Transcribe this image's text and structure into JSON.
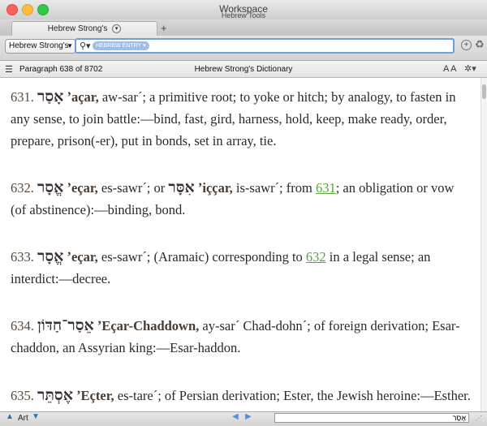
{
  "window": {
    "title": "Workspace",
    "subtitle": "Hebrew Tools"
  },
  "tab": {
    "label": "Hebrew Strong's",
    "add_symbol": "+"
  },
  "toolbar": {
    "resource": "Hebrew Strong's",
    "search_token": "HEBREW ENTRY",
    "search_value": "",
    "search_placeholder": ""
  },
  "infobar": {
    "paragraph": "Paragraph 638 of 8702",
    "doc_title": "Hebrew Strong's Dictionary",
    "font_control": "A A"
  },
  "entries": [
    {
      "num": "631.",
      "hebrew": "אָסַר",
      "translit": "ʼaçar,",
      "text": " aw-sar´; a primitive root; to yoke or hitch; by analogy, to fasten in any sense, to join battle:—bind, fast, gird, harness, hold, keep, make ready, order, prepare, prison(-er), put in bonds, set in array, tie."
    },
    {
      "num": "632.",
      "hebrew": "אֱסָר",
      "translit": "ʼeçar,",
      "text_a": " es-sawr´; or ",
      "hebrew2": "אִסָּר",
      "translit2": "ʼiççar,",
      "text_b": " is-sawr´; from ",
      "link": "631",
      "text_c": "; an obligation or vow (of abstinence):—binding, bond."
    },
    {
      "num": "633.",
      "hebrew": "אֱסָר",
      "translit": "ʼeçar,",
      "text_a": " es-sawr´; (Aramaic) corresponding to ",
      "link": "632",
      "text_b": " in a legal sense; an interdict:—decree."
    },
    {
      "num": "634.",
      "hebrew": "אֵסַר־חַדּוֹן",
      "translit": "ʼEçar-Chaddown,",
      "text": " ay-sar´ Chad-dohn´; of foreign derivation; Esar-chaddon, an Assyrian king:—Esar-haddon."
    },
    {
      "num": "635.",
      "hebrew": "אֶסְתֵּר",
      "translit": "ʼEçter,",
      "text": " es-tare´; of Persian derivation; Ester, the Jewish heroine:—Esther."
    }
  ],
  "statusbar": {
    "label": "Art",
    "field_value": "אָסַר"
  },
  "colors": {
    "link": "#56a63a",
    "search_border": "#6e9fdc",
    "token": "#9fbde6"
  }
}
